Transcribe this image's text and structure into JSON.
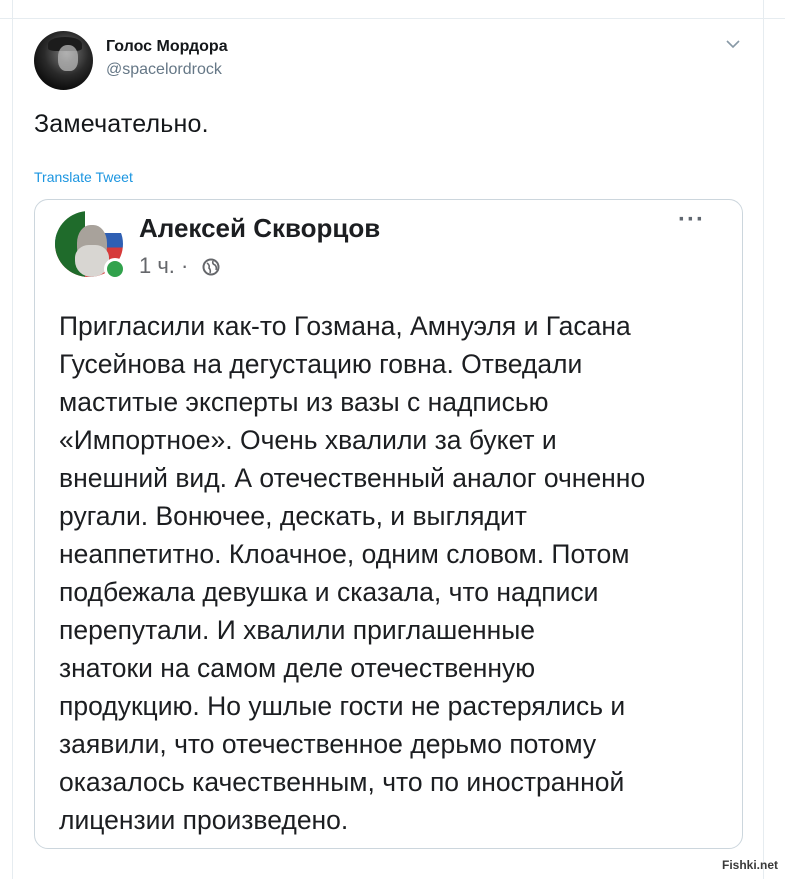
{
  "tweet": {
    "author_name": "Голос Мордора",
    "author_handle": "@spacelordrock",
    "text": "Замечательно.",
    "translate_label": "Translate Tweet"
  },
  "fb_post": {
    "author_name": "Алексей Скворцов",
    "time": "1 ч. ·",
    "more_label": "···",
    "lines": [
      "Пригласили как-то Гозмана, Амнуэля и Гасана",
      "Гусейнова на дегустацию говна. Отведали",
      "маститые эксперты из вазы с надписью",
      "«Импортное». Очень хвалили за букет и",
      "внешний вид. А отечественный аналог очненно",
      "ругали. Вонючее, дескать, и выглядит",
      "неаппетитно. Клоачное, одним словом. Потом",
      "подбежала девушка и сказала, что надписи",
      "перепутали. И хвалили приглашенные",
      "знатоки на самом деле отечественную",
      "продукцию. Но ушлые гости не растерялись и",
      "заявили, что отечественное дерьмо потому",
      "оказалось качественным, что по иностранной",
      "лицензии произведено."
    ]
  },
  "watermark": "Fishki.net",
  "icons": {
    "caret": "chevron-down-icon",
    "globe": "globe-icon",
    "online": "online-status-icon"
  },
  "colors": {
    "link": "#1b95e0",
    "secondary_text": "#657786",
    "online": "#31a24c"
  }
}
